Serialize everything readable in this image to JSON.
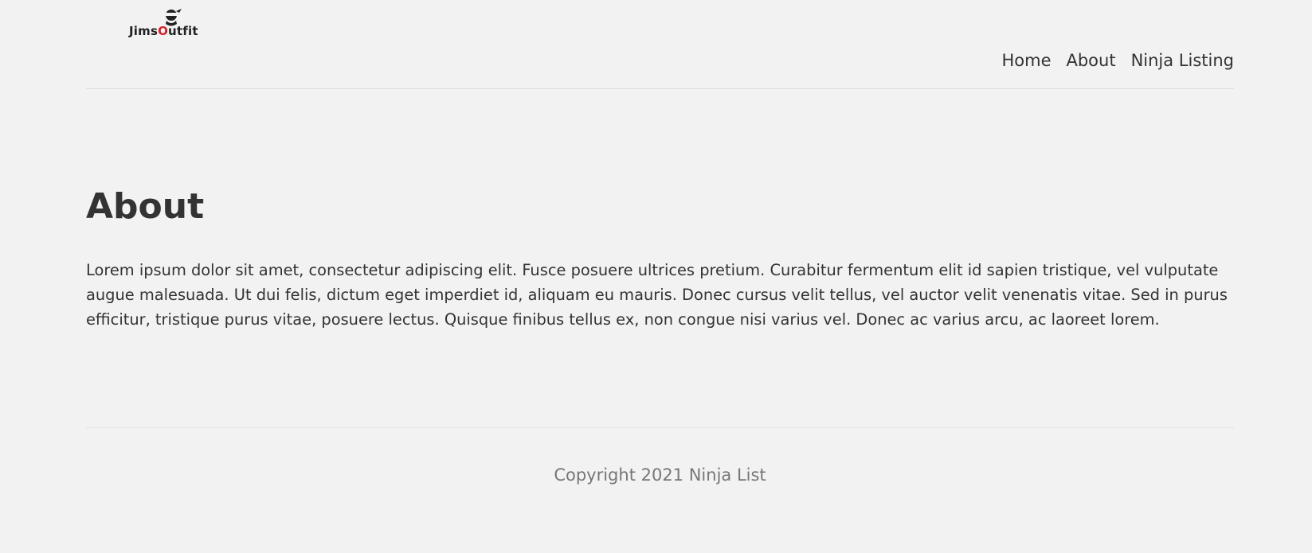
{
  "header": {
    "logo": {
      "text_main": "Jims",
      "text_accent": "O",
      "text_tail": "utfit",
      "icon": "ninja-head-icon"
    },
    "nav": [
      {
        "label": "Home"
      },
      {
        "label": "About"
      },
      {
        "label": "Ninja Listing"
      }
    ]
  },
  "main": {
    "title": "About",
    "body": "Lorem ipsum dolor sit amet, consectetur adipiscing elit. Fusce posuere ultrices pretium. Curabitur fermentum elit id sapien tristique, vel vulputate augue malesuada. Ut dui felis, dictum eget imperdiet id, aliquam eu mauris. Donec cursus velit tellus, vel auctor velit venenatis vitae. Sed in purus efficitur, tristique purus vitae, posuere lectus. Quisque finibus tellus ex, non congue nisi varius vel. Donec ac varius arcu, ac laoreet lorem."
  },
  "footer": {
    "copyright": "Copyright 2021 Ninja List"
  },
  "colors": {
    "background": "#f2f2f2",
    "text": "#333333",
    "muted": "#777777",
    "logo_accent": "#d2232a"
  }
}
